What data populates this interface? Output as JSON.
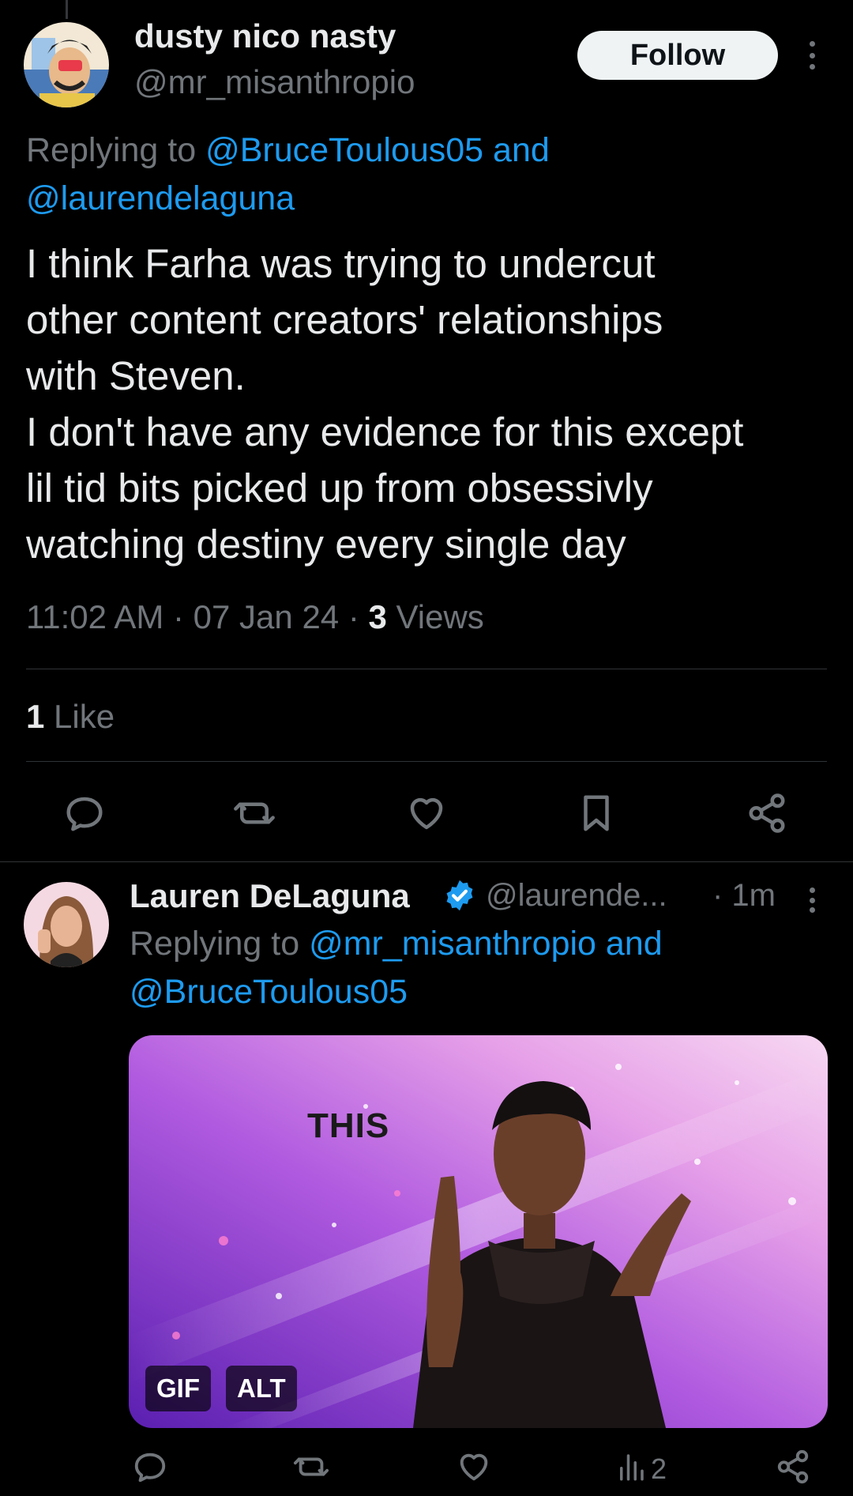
{
  "main_tweet": {
    "display_name": "dusty nico nasty",
    "handle": "@mr_misanthropio",
    "follow_label": "Follow",
    "replying_prefix": "Replying to ",
    "replying_mention_1": "@BruceToulous05",
    "replying_joiner": " and",
    "replying_mention_2": "@laurendelaguna",
    "body": "I think Farha was trying to undercut\nother content creators' relationships\nwith Steven.\nI don't have any evidence for this except\nlil tid bits picked up from obsessivly\nwatching destiny every single day",
    "time": "11:02 AM",
    "date": "07 Jan 24",
    "views_count": "3",
    "views_label": "Views",
    "likes_count": "1",
    "likes_label": "Like",
    "actions": [
      "reply-icon",
      "retweet-icon",
      "like-icon",
      "bookmark-icon",
      "share-icon"
    ]
  },
  "reply_tweet": {
    "display_name": "Lauren DeLaguna",
    "handle": "@laurende...",
    "time_ago": "· 1m",
    "replying_prefix": "Replying to ",
    "replying_mention_1": "@mr_misanthropio",
    "replying_joiner": " and",
    "replying_mention_2": "@BruceToulous05",
    "gif_caption": "THIS",
    "gif_badge": "GIF",
    "alt_badge": "ALT",
    "views": "2",
    "actions": [
      "reply-icon",
      "retweet-icon",
      "like-icon",
      "views-icon",
      "share-icon"
    ]
  },
  "colors": {
    "background": "#000000",
    "text": "#e7e9ea",
    "secondary": "#71767b",
    "link": "#1d9bf0",
    "divider": "#2f3336"
  }
}
